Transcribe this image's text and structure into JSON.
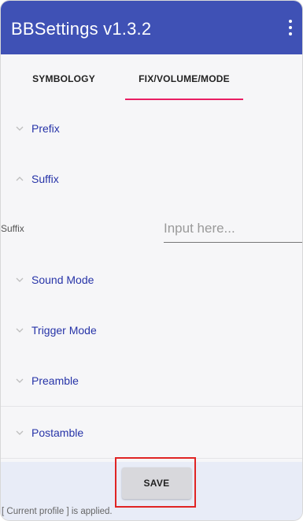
{
  "appbar": {
    "title": "BBSettings v1.3.2",
    "menu_icon": "more-vert-icon",
    "color": "#3f51b5"
  },
  "tabs": [
    {
      "label": "SYMBOLOGY",
      "selected": false
    },
    {
      "label": "FIX/VOLUME/MODE",
      "selected": true
    }
  ],
  "accent_color": "#e91e63",
  "sections": {
    "prefix": {
      "label": "Prefix",
      "expanded": false,
      "icon": "chevron-down-icon"
    },
    "suffix": {
      "label": "Suffix",
      "expanded": true,
      "icon": "chevron-up-icon"
    },
    "sound_mode": {
      "label": "Sound Mode",
      "expanded": false,
      "icon": "chevron-down-icon"
    },
    "trigger_mode": {
      "label": "Trigger Mode",
      "expanded": false,
      "icon": "chevron-down-icon"
    },
    "preamble": {
      "label": "Preamble",
      "expanded": false,
      "icon": "chevron-down-icon"
    },
    "postamble": {
      "label": "Postamble",
      "expanded": false,
      "icon": "chevron-down-icon"
    }
  },
  "suffix_field": {
    "label": "Suffix",
    "value": "",
    "placeholder": "Input here..."
  },
  "footer": {
    "save_label": "SAVE",
    "status": "[ Current profile ] is applied."
  }
}
